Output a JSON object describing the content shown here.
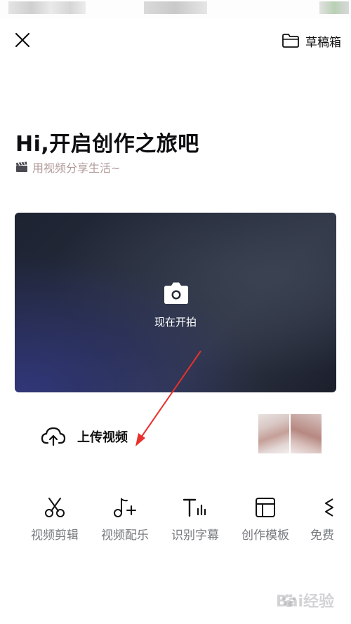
{
  "header": {
    "close_icon": "close-icon",
    "drafts_icon": "folder-icon",
    "drafts_label": "草稿箱"
  },
  "hero": {
    "title": "Hi,开启创作之旅吧",
    "subtitle_icon": "clapperboard-icon",
    "subtitle": "用视频分享生活~"
  },
  "camera": {
    "icon": "camera-icon",
    "label": "现在开拍"
  },
  "upload": {
    "icon": "cloud-upload-icon",
    "label": "上传视频"
  },
  "tools": [
    {
      "icon": "scissors-icon",
      "label": "视频剪辑"
    },
    {
      "icon": "music-note-add-icon",
      "label": "视频配乐"
    },
    {
      "icon": "text-audio-icon",
      "label": "识别字幕"
    },
    {
      "icon": "template-layout-icon",
      "label": "创作模板"
    },
    {
      "icon": "free-icon",
      "label": "免费"
    }
  ],
  "watermark": "Bai经验",
  "colors": {
    "annotation_arrow": "#e8312c",
    "subtitle_text": "#b09a98",
    "tool_label": "#777b80"
  }
}
